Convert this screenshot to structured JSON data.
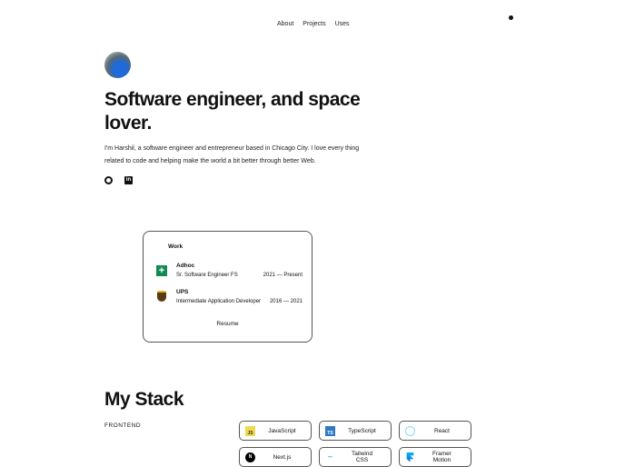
{
  "nav": {
    "items": [
      "About",
      "Projects",
      "Uses"
    ]
  },
  "hero": {
    "title": "Software engineer, and space lover.",
    "bio": "I'm Harshil, a software engineer and entrepreneur based in Chicago City. I love every thing related to code and helping make the world a bit better through better Web."
  },
  "work": {
    "title": "Work",
    "jobs": [
      {
        "company": "Adhoc",
        "role": "Sr. Software Engineer FS",
        "period": "2021 — Present"
      },
      {
        "company": "UPS",
        "role": "Intermediate Application Developer",
        "period": "2016 — 2021"
      }
    ],
    "resume": "Resume"
  },
  "stack": {
    "title": "My Stack",
    "section": "FRONTEND",
    "items": [
      {
        "name": "JavaScript",
        "icon": "JS"
      },
      {
        "name": "TypeScript",
        "icon": "TS"
      },
      {
        "name": "React"
      },
      {
        "name": "Next.js",
        "icon": "N"
      },
      {
        "name": "Tailwind CSS"
      },
      {
        "name": "Framer Motion"
      }
    ]
  }
}
